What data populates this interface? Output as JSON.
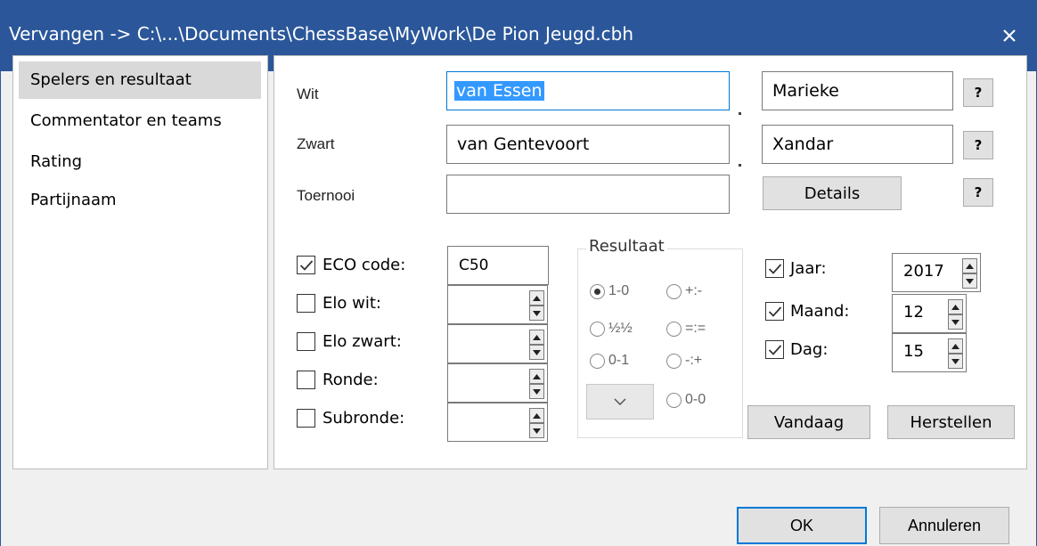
{
  "window": {
    "title": "Vervangen -> C:\\...\\Documents\\ChessBase\\MyWork\\De Pion Jeugd.cbh",
    "close_icon": "close-icon"
  },
  "nav": {
    "items": [
      {
        "label": "Spelers en resultaat",
        "selected": true
      },
      {
        "label": "Commentator en teams",
        "selected": false
      },
      {
        "label": "Rating",
        "selected": false
      },
      {
        "label": "Partijnaam",
        "selected": false
      }
    ]
  },
  "players": {
    "wit_label": "Wit",
    "wit_lastname": "van Essen",
    "wit_firstname": "Marieke",
    "zwart_label": "Zwart",
    "zwart_lastname": "van Gentevoort",
    "zwart_firstname": "Xandar",
    "toernooi_label": "Toernooi",
    "toernooi_value": "",
    "details_label": "Details",
    "help_label": "?"
  },
  "options": {
    "eco": {
      "label": "ECO code:",
      "checked": true,
      "value": "C50"
    },
    "elo_wit": {
      "label": "Elo wit:",
      "checked": false,
      "value": ""
    },
    "elo_zwart": {
      "label": "Elo zwart:",
      "checked": false,
      "value": ""
    },
    "ronde": {
      "label": "Ronde:",
      "checked": false,
      "value": ""
    },
    "subronde": {
      "label": "Subronde:",
      "checked": false,
      "value": ""
    }
  },
  "result": {
    "title": "Resultaat",
    "options": [
      {
        "label": "1-0",
        "selected": true
      },
      {
        "label": "+:-",
        "selected": false
      },
      {
        "label": "½½",
        "selected": false
      },
      {
        "label": "=:=",
        "selected": false
      },
      {
        "label": "0-1",
        "selected": false
      },
      {
        "label": "-:+",
        "selected": false
      },
      {
        "label": "0-0",
        "selected": false
      }
    ]
  },
  "date": {
    "jaar": {
      "label": "Jaar:",
      "checked": true,
      "value": "2017"
    },
    "maand": {
      "label": "Maand:",
      "checked": true,
      "value": "12"
    },
    "dag": {
      "label": "Dag:",
      "checked": true,
      "value": "15"
    },
    "vandaag_label": "Vandaag",
    "herstellen_label": "Herstellen"
  },
  "footer": {
    "ok_label": "OK",
    "cancel_label": "Annuleren"
  },
  "colors": {
    "titlebar": "#2b579a",
    "selection": "#3399ff",
    "focus_border": "#0078d7"
  }
}
